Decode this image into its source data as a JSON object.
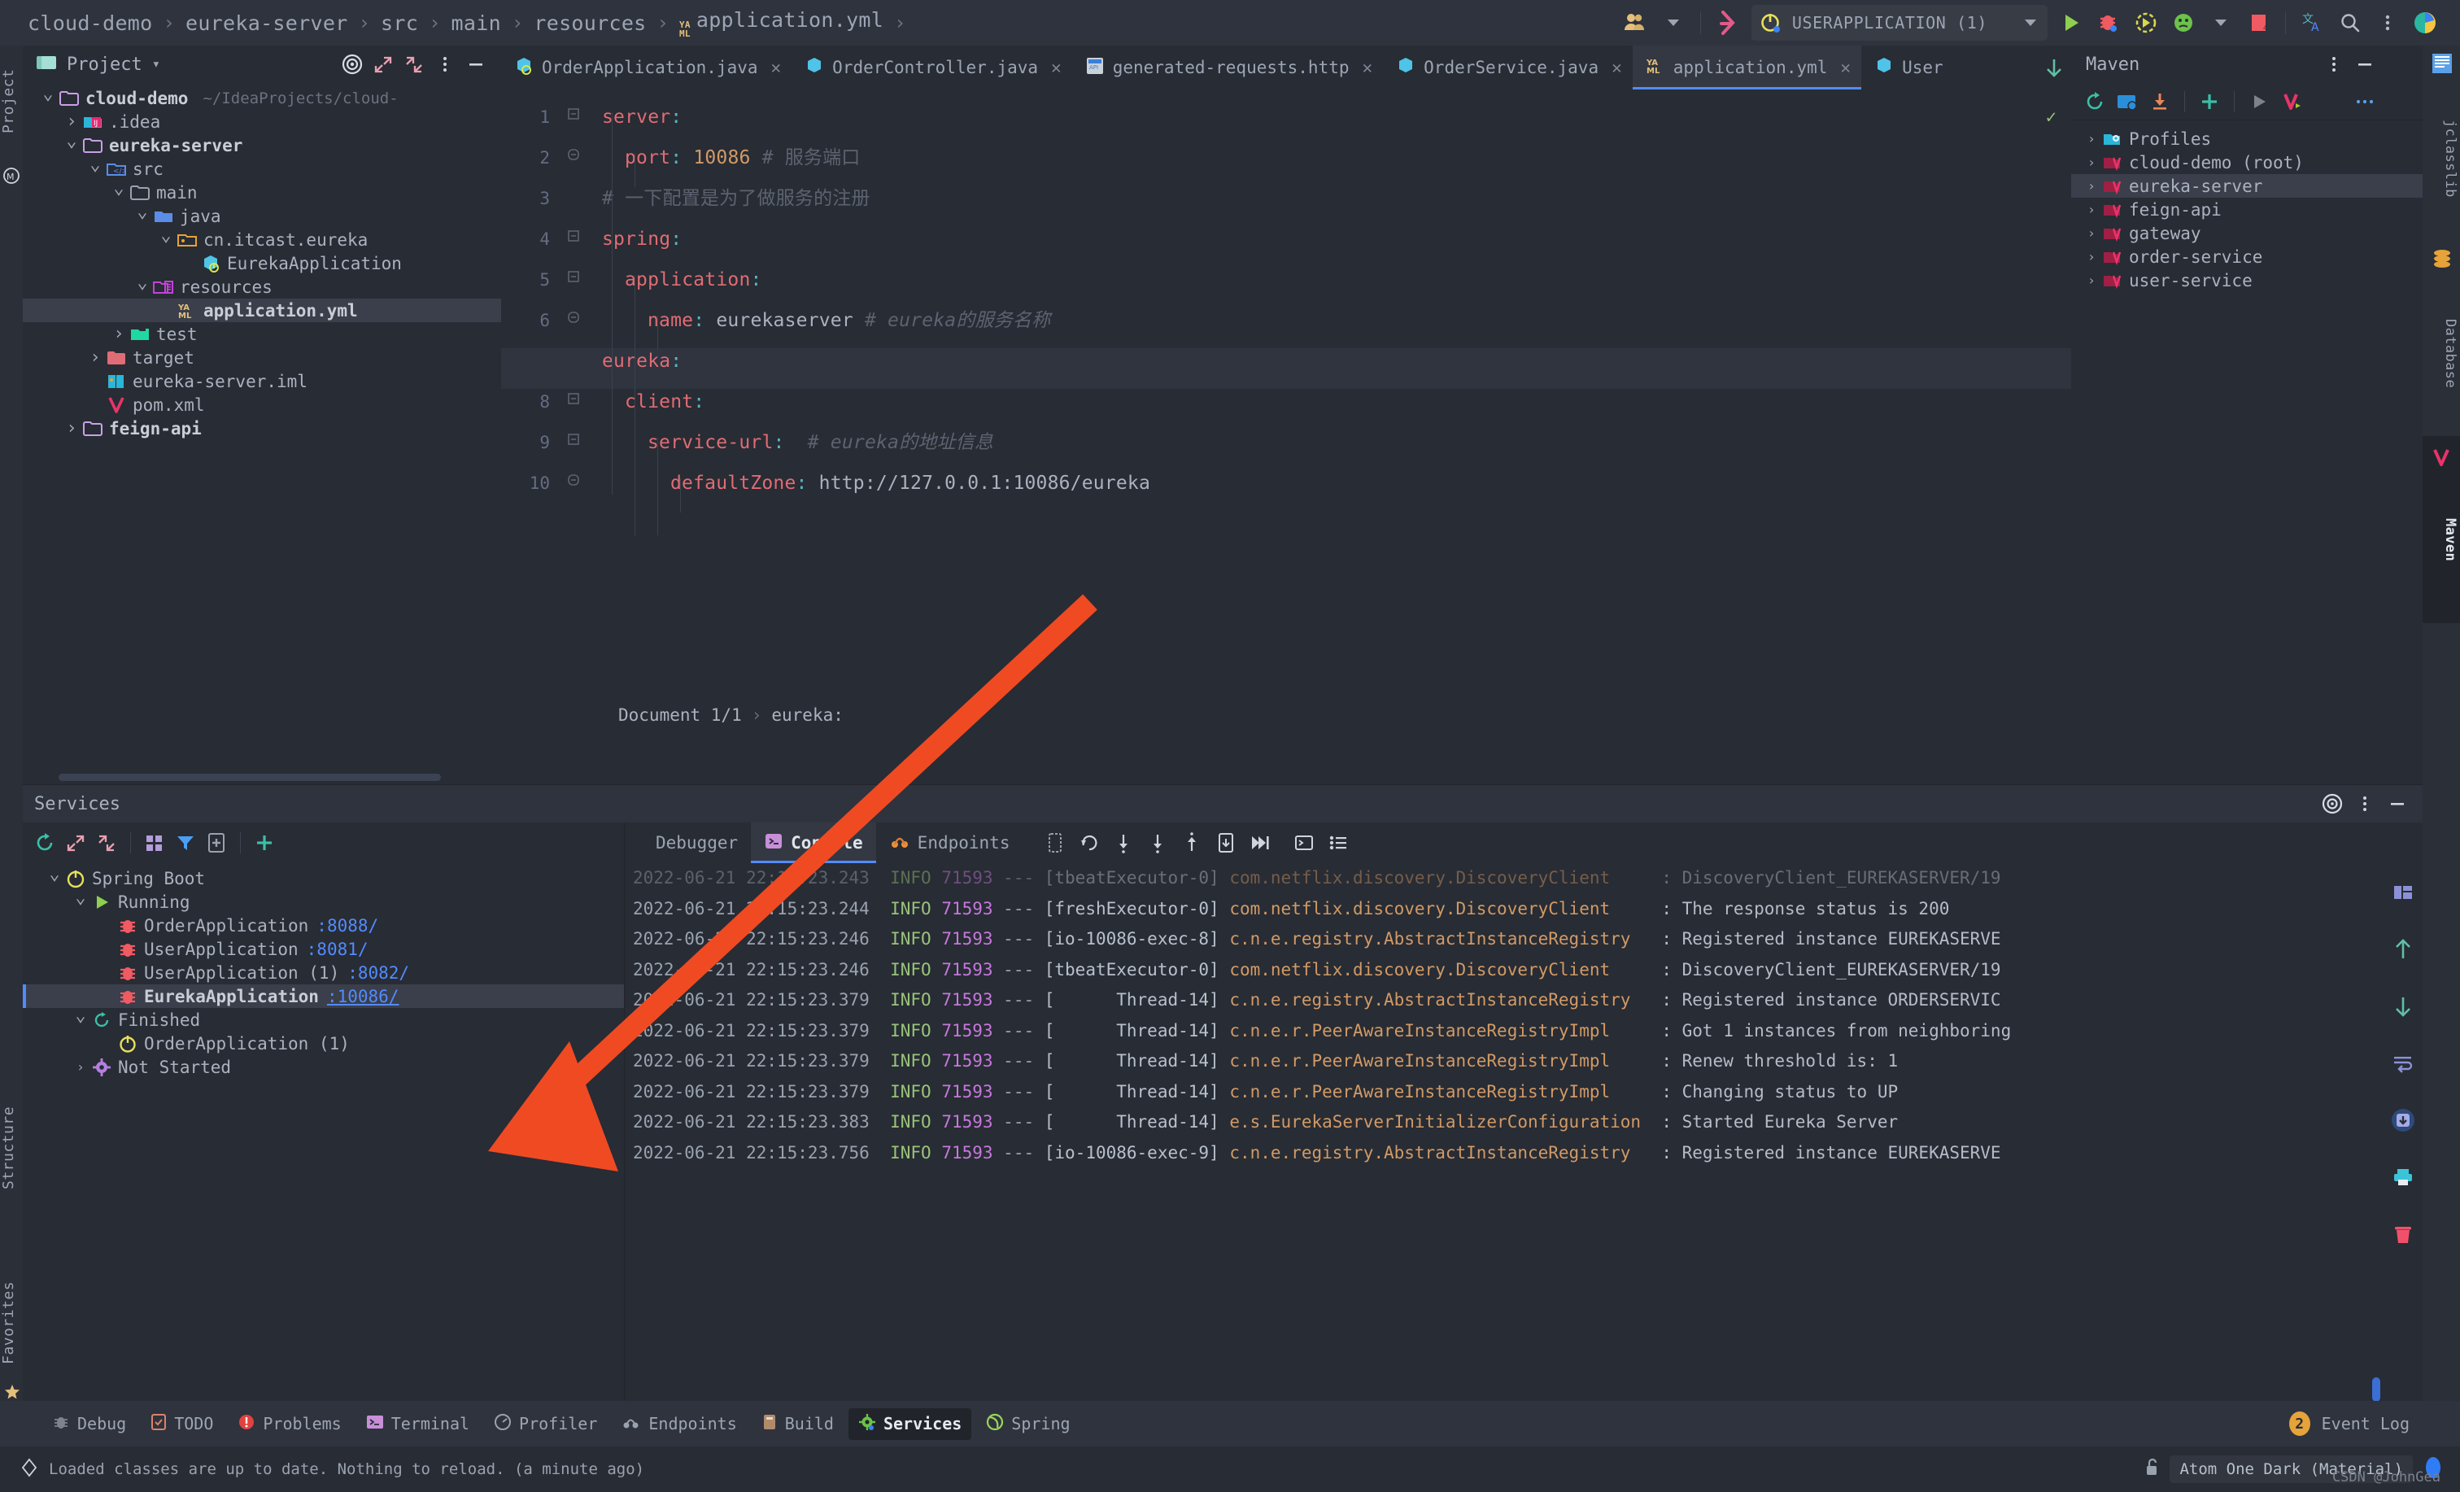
{
  "breadcrumb": {
    "items": [
      "cloud-demo",
      "eureka-server",
      "src",
      "main",
      "resources",
      "application.yml"
    ],
    "file_icon": "yaml-icon",
    "trailing_sep": "›"
  },
  "toolbar": {
    "run_config": "USERAPPLICATION (1)",
    "icons": [
      "users-icon",
      "git-branch-icon",
      "run-config-power-icon",
      "run-icon",
      "debug-icon",
      "run-with-coverage-icon",
      "profiler-icon",
      "stop-icon",
      "translate-icon",
      "search-icon",
      "more-icon",
      "ide-logo-icon"
    ]
  },
  "project_panel": {
    "title": "Project",
    "header_icons": [
      "target-icon",
      "expand-icon",
      "collapse-icon",
      "more-icon",
      "minimize-icon"
    ],
    "tree": [
      {
        "label": "cloud-demo",
        "path": "~/IdeaProjects/cloud-",
        "depth": 0,
        "twist": "open",
        "icon": "folder-module-icon",
        "bold": true
      },
      {
        "label": ".idea",
        "depth": 1,
        "twist": "closed",
        "icon": "idea-folder-icon",
        "bold": false
      },
      {
        "label": "eureka-server",
        "depth": 1,
        "twist": "open",
        "icon": "folder-module-icon",
        "bold": true
      },
      {
        "label": "src",
        "depth": 2,
        "twist": "open",
        "icon": "src-folder-icon",
        "bold": false
      },
      {
        "label": "main",
        "depth": 3,
        "twist": "open",
        "icon": "folder-icon",
        "bold": false
      },
      {
        "label": "java",
        "depth": 4,
        "twist": "open",
        "icon": "java-source-folder-icon",
        "bold": false
      },
      {
        "label": "cn.itcast.eureka",
        "depth": 5,
        "twist": "open",
        "icon": "package-icon",
        "bold": false
      },
      {
        "label": "EurekaApplication",
        "depth": 6,
        "twist": "none",
        "icon": "spring-class-icon",
        "bold": false
      },
      {
        "label": "resources",
        "depth": 4,
        "twist": "open",
        "icon": "resources-folder-icon",
        "bold": false
      },
      {
        "label": "application.yml",
        "depth": 5,
        "twist": "none",
        "icon": "yaml-icon",
        "bold": true,
        "selected": true
      },
      {
        "label": "test",
        "depth": 3,
        "twist": "closed",
        "icon": "test-folder-icon",
        "bold": false
      },
      {
        "label": "target",
        "depth": 2,
        "twist": "closed",
        "icon": "target-folder-icon",
        "bold": false
      },
      {
        "label": "eureka-server.iml",
        "depth": 2,
        "twist": "none",
        "icon": "iml-icon",
        "bold": false
      },
      {
        "label": "pom.xml",
        "depth": 2,
        "twist": "none",
        "icon": "maven-icon",
        "bold": false
      },
      {
        "label": "feign-api",
        "depth": 1,
        "twist": "closed",
        "icon": "folder-module-icon",
        "bold": true
      }
    ]
  },
  "editor": {
    "tabs": [
      {
        "label": "OrderApplication.java",
        "icon": "spring-class-icon",
        "active": false
      },
      {
        "label": "OrderController.java",
        "icon": "java-class-icon",
        "active": false
      },
      {
        "label": "generated-requests.http",
        "icon": "http-icon",
        "active": false
      },
      {
        "label": "OrderService.java",
        "icon": "java-class-icon",
        "active": false
      },
      {
        "label": "application.yml",
        "icon": "yaml-icon",
        "active": true
      },
      {
        "label": "User",
        "icon": "java-class-icon",
        "active": false
      }
    ],
    "overflow_icon": "chevron-down-icon",
    "current_line": 7,
    "lines": [
      {
        "n": 1,
        "indent": 0,
        "fold": "open",
        "parts": [
          {
            "t": "server",
            "c": "k-key"
          },
          {
            "t": ":",
            "c": "k-punct"
          }
        ]
      },
      {
        "n": 2,
        "indent": 1,
        "fold": "leaf",
        "parts": [
          {
            "t": "port",
            "c": "k-key"
          },
          {
            "t": ": ",
            "c": "k-punct"
          },
          {
            "t": "10086",
            "c": "k-num"
          },
          {
            "t": " # 服务端口",
            "c": "k-cmt"
          }
        ]
      },
      {
        "n": 3,
        "indent": 0,
        "fold": "none",
        "parts": [
          {
            "t": "# 一下配置是为了做服务的注册",
            "c": "k-cmt"
          }
        ]
      },
      {
        "n": 4,
        "indent": 0,
        "fold": "open",
        "parts": [
          {
            "t": "spring",
            "c": "k-key"
          },
          {
            "t": ":",
            "c": "k-punct"
          }
        ]
      },
      {
        "n": 5,
        "indent": 1,
        "fold": "open",
        "parts": [
          {
            "t": "application",
            "c": "k-key"
          },
          {
            "t": ":",
            "c": "k-punct"
          }
        ]
      },
      {
        "n": 6,
        "indent": 2,
        "fold": "leaf",
        "parts": [
          {
            "t": "name",
            "c": "k-key"
          },
          {
            "t": ": ",
            "c": "k-punct"
          },
          {
            "t": "eurekaserver",
            "c": "k-str"
          },
          {
            "t": " # ",
            "c": "k-cmt"
          },
          {
            "t": "eureka的服务名称",
            "c": "k-cmt-i"
          }
        ]
      },
      {
        "n": 7,
        "indent": 0,
        "fold": "open",
        "parts": [
          {
            "t": "eureka",
            "c": "k-key"
          },
          {
            "t": ":",
            "c": "k-punct"
          }
        ]
      },
      {
        "n": 8,
        "indent": 1,
        "fold": "open",
        "parts": [
          {
            "t": "client",
            "c": "k-key"
          },
          {
            "t": ":",
            "c": "k-punct"
          }
        ]
      },
      {
        "n": 9,
        "indent": 2,
        "fold": "open",
        "parts": [
          {
            "t": "service-url",
            "c": "k-key"
          },
          {
            "t": ":",
            "c": "k-punct"
          },
          {
            "t": "  # ",
            "c": "k-cmt"
          },
          {
            "t": "eureka的地址信息",
            "c": "k-cmt-i"
          }
        ]
      },
      {
        "n": 10,
        "indent": 3,
        "fold": "leaf",
        "parts": [
          {
            "t": "defaultZone",
            "c": "k-key"
          },
          {
            "t": ": ",
            "c": "k-punct"
          },
          {
            "t": "http://127.0.0.1:10086/eureka",
            "c": "k-str"
          }
        ]
      }
    ],
    "status_breadcrumb": {
      "document": "Document 1/1",
      "sep": "›",
      "node": "eureka:"
    }
  },
  "maven_panel": {
    "title": "Maven",
    "header_icons": [
      "more-icon",
      "minimize-icon"
    ],
    "toolbar_icons": [
      "reload-icon",
      "add-project-icon",
      "download-sources-icon",
      "add-icon",
      "run-goal-icon",
      "maven-icon",
      "more-icon"
    ],
    "tree": [
      {
        "label": "Profiles",
        "icon": "profiles-icon",
        "selected": false
      },
      {
        "label": "cloud-demo (root)",
        "icon": "maven-module-icon",
        "selected": false
      },
      {
        "label": "eureka-server",
        "icon": "maven-module-icon",
        "selected": true
      },
      {
        "label": "feign-api",
        "icon": "maven-module-icon",
        "selected": false
      },
      {
        "label": "gateway",
        "icon": "maven-module-icon",
        "selected": false
      },
      {
        "label": "order-service",
        "icon": "maven-module-icon",
        "selected": false
      },
      {
        "label": "user-service",
        "icon": "maven-module-icon",
        "selected": false
      }
    ]
  },
  "right_strip": {
    "labels": [
      "jclasslib",
      "Database",
      "Maven"
    ],
    "active": "Maven"
  },
  "left_strip": {
    "top_labels": [
      "Project"
    ],
    "bottom_labels": [
      "Structure",
      "Favorites"
    ]
  },
  "services_panel": {
    "title": "Services",
    "header_icons": [
      "settings-icon",
      "more-icon",
      "minimize-icon"
    ],
    "toolbar_icons": [
      "rerun-icon",
      "expand-icon",
      "collapse-icon",
      "group-icon",
      "filter-icon",
      "new-file-icon",
      "add-icon"
    ],
    "tree": [
      {
        "label": "Spring Boot",
        "depth": 0,
        "twist": "open",
        "icon": "spring-boot-icon",
        "port": "",
        "selected": false
      },
      {
        "label": "Running",
        "depth": 1,
        "twist": "open",
        "icon": "run-icon",
        "port": "",
        "selected": false
      },
      {
        "label": "OrderApplication",
        "depth": 2,
        "twist": "none",
        "icon": "debug-icon",
        "port": ":8088/",
        "selected": false
      },
      {
        "label": "UserApplication",
        "depth": 2,
        "twist": "none",
        "icon": "debug-icon",
        "port": ":8081/",
        "selected": false
      },
      {
        "label": "UserApplication (1)",
        "depth": 2,
        "twist": "none",
        "icon": "debug-icon",
        "port": ":8082/",
        "selected": false
      },
      {
        "label": "EurekaApplication",
        "depth": 2,
        "twist": "none",
        "icon": "debug-icon",
        "port": ":10086/",
        "selected": true
      },
      {
        "label": "Finished",
        "depth": 1,
        "twist": "open",
        "icon": "finished-icon",
        "port": "",
        "selected": false
      },
      {
        "label": "OrderApplication (1)",
        "depth": 2,
        "twist": "none",
        "icon": "power-icon",
        "port": "",
        "selected": false
      },
      {
        "label": "Not Started",
        "depth": 1,
        "twist": "closed",
        "icon": "gear-icon",
        "port": "",
        "selected": false
      }
    ],
    "left_rail_icons": [
      "debug-icon",
      "stop-icon",
      "gear-icon",
      "step-over-icon",
      "pause-icon",
      "record-icon",
      "thread-icon",
      "camera-icon",
      "layout-icon",
      "more-icon"
    ],
    "console_tabs": [
      {
        "label": "Debugger",
        "icon": "",
        "active": false
      },
      {
        "label": "Console",
        "icon": "console-icon",
        "active": true
      },
      {
        "label": "Endpoints",
        "icon": "endpoints-icon",
        "active": false
      }
    ],
    "console_toolbar_icons": [
      "soft-wrap-icon",
      "rerun-icon",
      "step-down-icon",
      "step-into-icon",
      "step-out-icon",
      "evaluate-icon",
      "resume-icon",
      "console-toggle-icon",
      "settings-list-icon"
    ],
    "console_right_icons": [
      "layout-icon",
      "up-arrow-icon",
      "down-arrow-icon",
      "soft-wrap-icon",
      "scroll-to-end-icon",
      "print-icon",
      "trash-icon"
    ],
    "console_lines": [
      {
        "ts": "2022-06-21 22:15:23.243",
        "level": "INFO",
        "pid": "71593",
        "thread": "[tbeatExecutor-0]",
        "cls": "com.netflix.discovery.DiscoveryClient",
        "msg": ": DiscoveryClient_EUREKASERVER/19",
        "faded": true
      },
      {
        "ts": "2022-06-21 22:15:23.244",
        "level": "INFO",
        "pid": "71593",
        "thread": "[freshExecutor-0]",
        "cls": "com.netflix.discovery.DiscoveryClient",
        "msg": ": The response status is 200",
        "faded": false
      },
      {
        "ts": "2022-06-21 22:15:23.246",
        "level": "INFO",
        "pid": "71593",
        "thread": "[io-10086-exec-8]",
        "cls": "c.n.e.registry.AbstractInstanceRegistry",
        "msg": ": Registered instance EUREKASERVE",
        "faded": false
      },
      {
        "ts": "2022-06-21 22:15:23.246",
        "level": "INFO",
        "pid": "71593",
        "thread": "[tbeatExecutor-0]",
        "cls": "com.netflix.discovery.DiscoveryClient",
        "msg": ": DiscoveryClient_EUREKASERVER/19",
        "faded": false
      },
      {
        "ts": "2022-06-21 22:15:23.379",
        "level": "INFO",
        "pid": "71593",
        "thread": "[      Thread-14]",
        "cls": "c.n.e.registry.AbstractInstanceRegistry",
        "msg": ": Registered instance ORDERSERVIC",
        "faded": false
      },
      {
        "ts": "2022-06-21 22:15:23.379",
        "level": "INFO",
        "pid": "71593",
        "thread": "[      Thread-14]",
        "cls": "c.n.e.r.PeerAwareInstanceRegistryImpl",
        "msg": ": Got 1 instances from neighboring",
        "faded": false
      },
      {
        "ts": "2022-06-21 22:15:23.379",
        "level": "INFO",
        "pid": "71593",
        "thread": "[      Thread-14]",
        "cls": "c.n.e.r.PeerAwareInstanceRegistryImpl",
        "msg": ": Renew threshold is: 1",
        "faded": false
      },
      {
        "ts": "2022-06-21 22:15:23.379",
        "level": "INFO",
        "pid": "71593",
        "thread": "[      Thread-14]",
        "cls": "c.n.e.r.PeerAwareInstanceRegistryImpl",
        "msg": ": Changing status to UP",
        "faded": false
      },
      {
        "ts": "2022-06-21 22:15:23.383",
        "level": "INFO",
        "pid": "71593",
        "thread": "[      Thread-14]",
        "cls": "e.s.EurekaServerInitializerConfiguration",
        "msg": ": Started Eureka Server",
        "faded": false
      },
      {
        "ts": "2022-06-21 22:15:23.756",
        "level": "INFO",
        "pid": "71593",
        "thread": "[io-10086-exec-9]",
        "cls": "c.n.e.registry.AbstractInstanceRegistry",
        "msg": ": Registered instance EUREKASERVE",
        "faded": false
      }
    ]
  },
  "tool_window_bar": {
    "items": [
      {
        "label": "Debug",
        "icon": "debug-icon",
        "active": false
      },
      {
        "label": "TODO",
        "icon": "todo-icon",
        "active": false
      },
      {
        "label": "Problems",
        "icon": "problems-icon",
        "active": false
      },
      {
        "label": "Terminal",
        "icon": "terminal-icon",
        "active": false
      },
      {
        "label": "Profiler",
        "icon": "profiler-icon",
        "active": false
      },
      {
        "label": "Endpoints",
        "icon": "endpoints-icon",
        "active": false
      },
      {
        "label": "Build",
        "icon": "build-icon",
        "active": false
      },
      {
        "label": "Services",
        "icon": "services-icon",
        "active": true
      },
      {
        "label": "Spring",
        "icon": "spring-icon",
        "active": false
      }
    ],
    "event_log": {
      "label": "Event Log",
      "count": "2"
    }
  },
  "status_bar": {
    "message": "Loaded classes are up to date. Nothing to reload. (a minute ago)",
    "theme": "Atom One Dark (Material)",
    "watermark": "CSDN @JohnGea"
  },
  "colors": {
    "bg": "#282c34",
    "panel": "#2f333d",
    "selection": "#3a3f4b",
    "accent": "#528bff",
    "key": "#e06c75",
    "number": "#d19a66",
    "comment": "#5c6370",
    "logclass": "#d19a66",
    "loglevel": "#98c379",
    "logpid": "#c678dd",
    "arrow": "#f04a23"
  }
}
